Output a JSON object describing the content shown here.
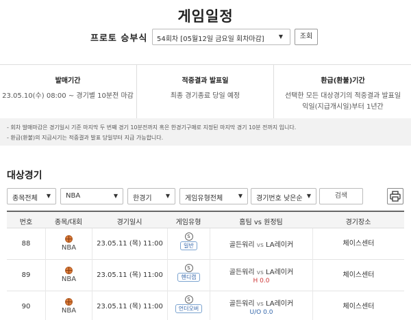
{
  "page": {
    "title": "게임일정"
  },
  "round": {
    "label": "프로토 승부식",
    "selected": "54회차 [05월12일 금요일 회차마감]",
    "view_button": "조회"
  },
  "info": [
    {
      "title": "발매기간",
      "lines": [
        "23.05.10(수) 08:00 ~ 경기별 10분전 마감"
      ]
    },
    {
      "title": "적중결과 발표일",
      "lines": [
        "최종 경기종료 당일 예정"
      ]
    },
    {
      "title": "환급(환불)기간",
      "lines": [
        "선택한 모든 대상경기의 적중결과 발표일",
        "익일(지급개시일)부터 1년간"
      ]
    }
  ],
  "notices": [
    "- 회차 발매마감은 경기일시 기준 마지막 두 번째 경기 10분전까지 혹은 한경기구매로 지정된 마지막 경기 10분 전까지 입니다.",
    "- 환급(환불)의 지급시기는 적중결과 발표 당일부터 지급 가능합니다."
  ],
  "section": {
    "title": "대상경기"
  },
  "filters": {
    "sport": "종목전체",
    "league": "NBA",
    "single": "한경기",
    "game_type": "게임유형전체",
    "sort": "경기번호 낮은순",
    "search_button": "검색"
  },
  "icons": {
    "print": "print-icon",
    "sport": "basketball-icon",
    "type": "s-circle-icon"
  },
  "colors": {
    "ball": "#d97a3a",
    "handicap": "#cc3333",
    "badge": "#3366aa"
  },
  "table": {
    "headers": [
      "번호",
      "종목/대회",
      "경기일시",
      "게임유형",
      "홈팀 vs 원정팀",
      "경기장소"
    ],
    "rows": [
      {
        "no": "88",
        "league": "NBA",
        "time": "23.05.11 (목) 11:00",
        "type_mark": "S",
        "type": "일반",
        "home": "골든워리",
        "vs": "vs",
        "away": "LA레이커",
        "sub": "",
        "venue": "체이스센터"
      },
      {
        "no": "89",
        "league": "NBA",
        "time": "23.05.11 (목) 11:00",
        "type_mark": "S",
        "type": "핸디캡",
        "home": "골든워리",
        "vs": "vs",
        "away": "LA레이커",
        "sub": "H 0.0",
        "venue": "체이스센터"
      },
      {
        "no": "90",
        "league": "NBA",
        "time": "23.05.11 (목) 11:00",
        "type_mark": "S",
        "type": "언더오버",
        "home": "골든워리",
        "vs": "vs",
        "away": "LA레이커",
        "sub": "U/O 0.0",
        "venue": "체이스센터"
      }
    ]
  }
}
